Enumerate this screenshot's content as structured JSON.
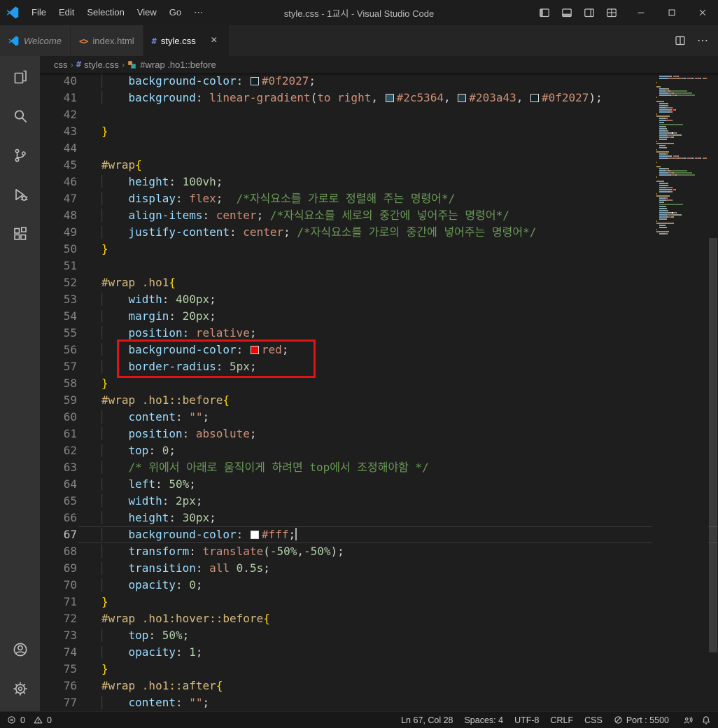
{
  "titlebar": {
    "title": "style.css - 1교시 - Visual Studio Code",
    "menus": [
      "File",
      "Edit",
      "Selection",
      "View",
      "Go",
      "⋯"
    ]
  },
  "tabbar": {
    "tabs": [
      {
        "label": "Welcome",
        "icon": "vscode-logo",
        "preview": true,
        "active": false
      },
      {
        "label": "index.html",
        "icon": "html",
        "preview": false,
        "active": false
      },
      {
        "label": "style.css",
        "icon": "css",
        "preview": false,
        "active": true
      }
    ]
  },
  "icons": {
    "close_glyph": "×",
    "html_glyph": "<>",
    "css_glyph": "#",
    "breadcrumb_separator": "›",
    "more_glyph": "⋯"
  },
  "breadcrumbs": [
    {
      "label": "css"
    },
    {
      "label": "style.css",
      "icon": "css"
    },
    {
      "label": "#wrap .ho1::before",
      "icon": "symbol"
    }
  ],
  "colors": {
    "tokens": {
      "p": "#9CDCFE",
      "v": "#CE9178",
      "n": "#B5CEA8",
      "c": "#6A9955",
      "s": "#D7BA7D",
      "d": "#D4D4D4",
      "b": "#FFD700"
    },
    "html_icon": "#E8824A",
    "css_icon": "#6A7FD6",
    "logo_blue": "#1F9CF0",
    "annotation_red": "#E01414",
    "activity_bar_bg": "#333333",
    "editor_bg": "#1E1E1E",
    "statusbar_bg": "#181818"
  },
  "annotation": {
    "shape": "rectangle",
    "color": "#E01414",
    "from_line": 56,
    "to_line": 57
  },
  "editor": {
    "current_line": 67,
    "lines": [
      {
        "n": 40,
        "t": [
          [
            "d",
            "    "
          ],
          [
            "p",
            "background-color"
          ],
          [
            "d",
            ": "
          ],
          [
            "sw",
            "#0f2027"
          ],
          [
            "v",
            "#0f2027"
          ],
          [
            "d",
            ";"
          ]
        ]
      },
      {
        "n": 41,
        "t": [
          [
            "d",
            "    "
          ],
          [
            "p",
            "background"
          ],
          [
            "d",
            ": "
          ],
          [
            "v",
            "linear-gradient"
          ],
          [
            "d",
            "("
          ],
          [
            "v",
            "to right"
          ],
          [
            "d",
            ", "
          ],
          [
            "sw",
            "#2c5364"
          ],
          [
            "v",
            "#2c5364"
          ],
          [
            "d",
            ", "
          ],
          [
            "sw",
            "#203a43"
          ],
          [
            "v",
            "#203a43"
          ],
          [
            "d",
            ", "
          ],
          [
            "sw",
            "#0f2027"
          ],
          [
            "v",
            "#0f2027"
          ],
          [
            "d",
            ");"
          ]
        ]
      },
      {
        "n": 42,
        "t": []
      },
      {
        "n": 43,
        "t": [
          [
            "b",
            "}"
          ]
        ]
      },
      {
        "n": 44,
        "t": []
      },
      {
        "n": 45,
        "t": [
          [
            "s",
            "#wrap"
          ],
          [
            "b",
            "{"
          ]
        ]
      },
      {
        "n": 46,
        "t": [
          [
            "d",
            "    "
          ],
          [
            "p",
            "height"
          ],
          [
            "d",
            ": "
          ],
          [
            "n",
            "100vh"
          ],
          [
            "d",
            ";"
          ]
        ]
      },
      {
        "n": 47,
        "t": [
          [
            "d",
            "    "
          ],
          [
            "p",
            "display"
          ],
          [
            "d",
            ": "
          ],
          [
            "v",
            "flex"
          ],
          [
            "d",
            ";  "
          ],
          [
            "c",
            "/*자식요소를 가로로 정렬해 주는 명령어*/"
          ]
        ]
      },
      {
        "n": 48,
        "t": [
          [
            "d",
            "    "
          ],
          [
            "p",
            "align-items"
          ],
          [
            "d",
            ": "
          ],
          [
            "v",
            "center"
          ],
          [
            "d",
            "; "
          ],
          [
            "c",
            "/*자식요소를 세로의 중간에 넣어주는 명령어*/"
          ]
        ]
      },
      {
        "n": 49,
        "t": [
          [
            "d",
            "    "
          ],
          [
            "p",
            "justify-content"
          ],
          [
            "d",
            ": "
          ],
          [
            "v",
            "center"
          ],
          [
            "d",
            "; "
          ],
          [
            "c",
            "/*자식요소를 가로의 중간에 넣어주는 명령어*/"
          ]
        ]
      },
      {
        "n": 50,
        "t": [
          [
            "b",
            "}"
          ]
        ]
      },
      {
        "n": 51,
        "t": []
      },
      {
        "n": 52,
        "t": [
          [
            "s",
            "#wrap .ho1"
          ],
          [
            "b",
            "{"
          ]
        ]
      },
      {
        "n": 53,
        "t": [
          [
            "d",
            "    "
          ],
          [
            "p",
            "width"
          ],
          [
            "d",
            ": "
          ],
          [
            "n",
            "400px"
          ],
          [
            "d",
            ";"
          ]
        ]
      },
      {
        "n": 54,
        "t": [
          [
            "d",
            "    "
          ],
          [
            "p",
            "margin"
          ],
          [
            "d",
            ": "
          ],
          [
            "n",
            "20px"
          ],
          [
            "d",
            ";"
          ]
        ]
      },
      {
        "n": 55,
        "t": [
          [
            "d",
            "    "
          ],
          [
            "p",
            "position"
          ],
          [
            "d",
            ": "
          ],
          [
            "v",
            "relative"
          ],
          [
            "d",
            ";"
          ]
        ]
      },
      {
        "n": 56,
        "t": [
          [
            "d",
            "    "
          ],
          [
            "p",
            "background-color"
          ],
          [
            "d",
            ": "
          ],
          [
            "sw",
            "#ff0000"
          ],
          [
            "v",
            "red"
          ],
          [
            "d",
            ";"
          ]
        ]
      },
      {
        "n": 57,
        "t": [
          [
            "d",
            "    "
          ],
          [
            "p",
            "border-radius"
          ],
          [
            "d",
            ": "
          ],
          [
            "n",
            "5px"
          ],
          [
            "d",
            ";"
          ]
        ]
      },
      {
        "n": 58,
        "t": [
          [
            "b",
            "}"
          ]
        ]
      },
      {
        "n": 59,
        "t": [
          [
            "s",
            "#wrap .ho1::before"
          ],
          [
            "b",
            "{"
          ]
        ]
      },
      {
        "n": 60,
        "t": [
          [
            "d",
            "    "
          ],
          [
            "p",
            "content"
          ],
          [
            "d",
            ": "
          ],
          [
            "v",
            "\"\""
          ],
          [
            "d",
            ";"
          ]
        ]
      },
      {
        "n": 61,
        "t": [
          [
            "d",
            "    "
          ],
          [
            "p",
            "position"
          ],
          [
            "d",
            ": "
          ],
          [
            "v",
            "absolute"
          ],
          [
            "d",
            ";"
          ]
        ]
      },
      {
        "n": 62,
        "t": [
          [
            "d",
            "    "
          ],
          [
            "p",
            "top"
          ],
          [
            "d",
            ": "
          ],
          [
            "n",
            "0"
          ],
          [
            "d",
            ";"
          ]
        ]
      },
      {
        "n": 63,
        "t": [
          [
            "d",
            "    "
          ],
          [
            "c",
            "/* 위에서 아래로 움직이게 하려면 top에서 조정해야함 */"
          ]
        ]
      },
      {
        "n": 64,
        "t": [
          [
            "d",
            "    "
          ],
          [
            "p",
            "left"
          ],
          [
            "d",
            ": "
          ],
          [
            "n",
            "50%"
          ],
          [
            "d",
            ";"
          ]
        ]
      },
      {
        "n": 65,
        "t": [
          [
            "d",
            "    "
          ],
          [
            "p",
            "width"
          ],
          [
            "d",
            ": "
          ],
          [
            "n",
            "2px"
          ],
          [
            "d",
            ";"
          ]
        ]
      },
      {
        "n": 66,
        "t": [
          [
            "d",
            "    "
          ],
          [
            "p",
            "height"
          ],
          [
            "d",
            ": "
          ],
          [
            "n",
            "30px"
          ],
          [
            "d",
            ";"
          ]
        ]
      },
      {
        "n": 67,
        "current": true,
        "t": [
          [
            "d",
            "    "
          ],
          [
            "p",
            "background-color"
          ],
          [
            "d",
            ": "
          ],
          [
            "sw",
            "#ffffff"
          ],
          [
            "v",
            "#fff"
          ],
          [
            "d",
            ";"
          ],
          [
            "caret",
            ""
          ]
        ]
      },
      {
        "n": 68,
        "t": [
          [
            "d",
            "    "
          ],
          [
            "p",
            "transform"
          ],
          [
            "d",
            ": "
          ],
          [
            "v",
            "translate"
          ],
          [
            "d",
            "("
          ],
          [
            "n",
            "-50%"
          ],
          [
            "d",
            ","
          ],
          [
            "n",
            "-50%"
          ],
          [
            "d",
            ");"
          ]
        ]
      },
      {
        "n": 69,
        "t": [
          [
            "d",
            "    "
          ],
          [
            "p",
            "transition"
          ],
          [
            "d",
            ": "
          ],
          [
            "v",
            "all"
          ],
          [
            "d",
            " "
          ],
          [
            "n",
            "0.5s"
          ],
          [
            "d",
            ";"
          ]
        ]
      },
      {
        "n": 70,
        "t": [
          [
            "d",
            "    "
          ],
          [
            "p",
            "opacity"
          ],
          [
            "d",
            ": "
          ],
          [
            "n",
            "0"
          ],
          [
            "d",
            ";"
          ]
        ]
      },
      {
        "n": 71,
        "t": [
          [
            "b",
            "}"
          ]
        ]
      },
      {
        "n": 72,
        "t": [
          [
            "s",
            "#wrap .ho1:hover::before"
          ],
          [
            "b",
            "{"
          ]
        ]
      },
      {
        "n": 73,
        "t": [
          [
            "d",
            "    "
          ],
          [
            "p",
            "top"
          ],
          [
            "d",
            ": "
          ],
          [
            "n",
            "50%"
          ],
          [
            "d",
            ";"
          ]
        ]
      },
      {
        "n": 74,
        "t": [
          [
            "d",
            "    "
          ],
          [
            "p",
            "opacity"
          ],
          [
            "d",
            ": "
          ],
          [
            "n",
            "1"
          ],
          [
            "d",
            ";"
          ]
        ]
      },
      {
        "n": 75,
        "t": [
          [
            "b",
            "}"
          ]
        ]
      },
      {
        "n": 76,
        "t": [
          [
            "s",
            "#wrap .ho1::after"
          ],
          [
            "b",
            "{"
          ]
        ]
      },
      {
        "n": 77,
        "t": [
          [
            "d",
            "    "
          ],
          [
            "p",
            "content"
          ],
          [
            "d",
            ": "
          ],
          [
            "v",
            "\"\""
          ],
          [
            "d",
            ";"
          ]
        ]
      }
    ]
  },
  "statusbar": {
    "errors": "0",
    "warnings": "0",
    "right": [
      {
        "name": "cursor-position",
        "label": "Ln 67, Col 28"
      },
      {
        "name": "indentation",
        "label": "Spaces: 4"
      },
      {
        "name": "encoding",
        "label": "UTF-8"
      },
      {
        "name": "eol",
        "label": "CRLF"
      },
      {
        "name": "language-mode",
        "label": "CSS"
      },
      {
        "name": "live-server-port",
        "label": "Port : 5500",
        "icon": "circle-slash"
      }
    ]
  }
}
